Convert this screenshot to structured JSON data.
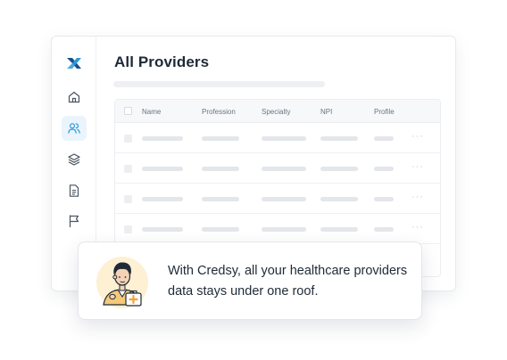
{
  "app": {
    "logo_icon": "credsy-logo-icon",
    "brand_colors": {
      "primary": "#1b4f8c",
      "accent": "#2a9bd8"
    }
  },
  "sidebar": {
    "items": [
      {
        "icon": "home-icon",
        "active": false
      },
      {
        "icon": "users-icon",
        "active": true
      },
      {
        "icon": "layers-icon",
        "active": false
      },
      {
        "icon": "document-icon",
        "active": false
      },
      {
        "icon": "flag-icon",
        "active": false
      }
    ]
  },
  "main": {
    "title": "All Providers",
    "table": {
      "columns": [
        "Name",
        "Profession",
        "Specialty",
        "NPI",
        "Profile"
      ],
      "row_count": 4
    }
  },
  "message": {
    "text": "With Credsy, all your healthcare providers data stays under one roof.",
    "avatar_icon": "doctor-avatar-icon"
  }
}
